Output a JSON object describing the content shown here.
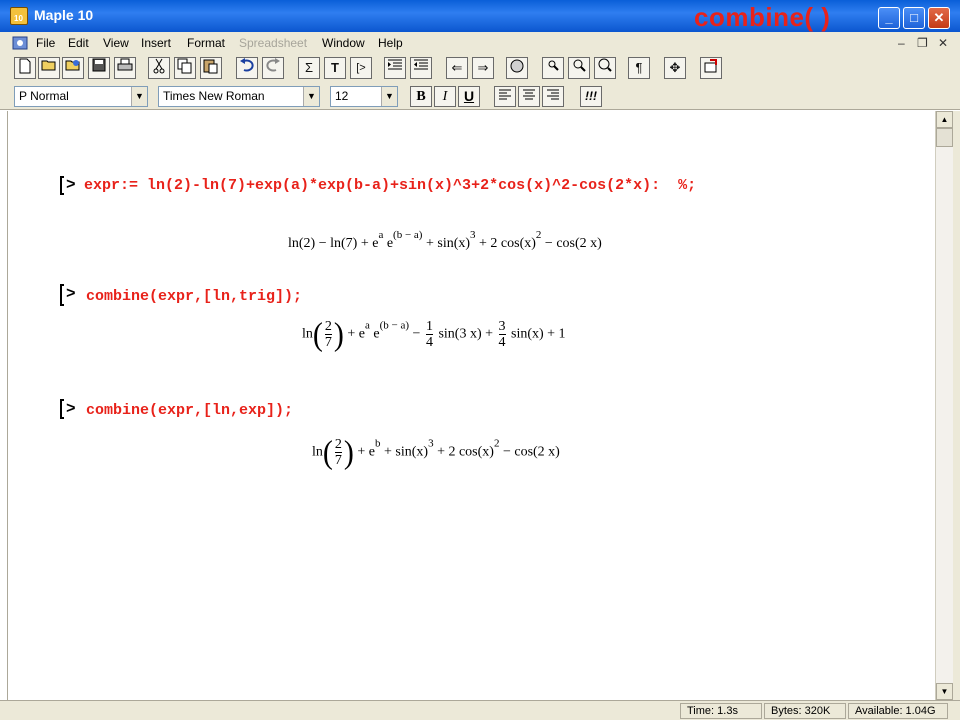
{
  "window": {
    "title": "Maple 10",
    "slide_caption": "combine( )",
    "controls": {
      "minimize": "_",
      "maximize": "□",
      "close": "✕"
    }
  },
  "menu": {
    "items": [
      {
        "label": "File",
        "disabled": false
      },
      {
        "label": "Edit",
        "disabled": false
      },
      {
        "label": "View",
        "disabled": false
      },
      {
        "label": "Insert",
        "disabled": false
      },
      {
        "label": "Format",
        "disabled": false
      },
      {
        "label": "Spreadsheet",
        "disabled": true
      },
      {
        "label": "Window",
        "disabled": false
      },
      {
        "label": "Help",
        "disabled": false
      }
    ],
    "mdi": {
      "minimize": "–",
      "restore": "❐",
      "close": "✕"
    }
  },
  "toolbar": {
    "icons": [
      "new-icon",
      "open-icon",
      "open-url-icon",
      "save-icon",
      "print-icon",
      "cut-icon",
      "copy-icon",
      "paste-icon",
      "undo-icon",
      "redo-icon",
      "sum-icon",
      "text-icon",
      "prompt-icon",
      "indent-icon",
      "outdent-icon",
      "back-icon",
      "forward-icon",
      "stop-icon",
      "zoom-100-icon",
      "zoom-200-icon",
      "zoom-400-icon",
      "pilcrow-icon",
      "expand-icon",
      "restart-icon"
    ],
    "glyphs": {
      "sum": "Σ",
      "text": "T",
      "prompt": "[>",
      "back": "⇐",
      "forward": "⇒",
      "pilcrow": "¶",
      "expand": "✥"
    }
  },
  "format": {
    "style": "P Normal",
    "font": "Times New Roman",
    "size": "12",
    "bold": "B",
    "italic": "I",
    "underline": "U",
    "exec": "!!!"
  },
  "worksheet": {
    "prompt_symbol": ">",
    "inputs": [
      {
        "command": "expr:= ln(2)-ln(7)+exp(a)*exp(b-a)+sin(x)^3+2*cos(x)^2-cos(2*x):  %;"
      },
      {
        "command": "combine(expr,[ln,trig]);"
      },
      {
        "command": "combine(expr,[ln,exp]);"
      }
    ],
    "outputs": {
      "out1": {
        "a": "ln(2) − ln(7) + e",
        "a_sup": "a",
        "b": " e",
        "b_sup": "(b − a)",
        "c": " + sin(x)",
        "c_sup": "3",
        "d": " + 2 cos(x)",
        "d_sup": "2",
        "e": " − cos(2 x)"
      },
      "out2": {
        "ln": "ln",
        "num": "2",
        "den": "7",
        "a": " + e",
        "a_sup": "a",
        "b": " e",
        "b_sup": "(b − a)",
        "c": " − ",
        "c_num": "1",
        "c_den": "4",
        "c_tail": " sin(3 x) + ",
        "d_num": "3",
        "d_den": "4",
        "d_tail": " sin(x) + 1"
      },
      "out3": {
        "ln": "ln",
        "num": "2",
        "den": "7",
        "a": " + e",
        "a_sup": "b",
        "b": " + sin(x)",
        "b_sup": "3",
        "c": " + 2 cos(x)",
        "c_sup": "2",
        "d": " − cos(2 x)"
      }
    }
  },
  "status": {
    "time": "Time:  1.3s",
    "bytes": "Bytes:  320K",
    "available": "Available:  1.04G"
  }
}
